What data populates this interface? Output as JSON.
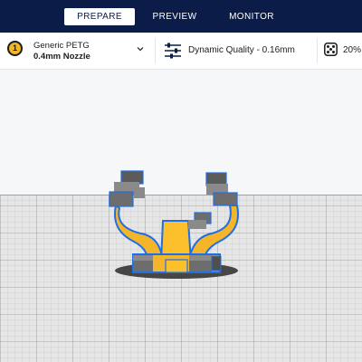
{
  "tabs": [
    {
      "label": "PREPARE",
      "active": true
    },
    {
      "label": "PREVIEW",
      "active": false
    },
    {
      "label": "MONITOR",
      "active": false
    }
  ],
  "material": {
    "extruder_number": "1",
    "name": "Generic PETG",
    "nozzle": "0.4mm Nozzle",
    "badge_color": "#f2b721"
  },
  "print_settings": {
    "quality": "Dynamic Quality - 0.16mm",
    "infill": "20%"
  },
  "colors": {
    "header": "#0a1c47",
    "model_fill": "#fcc02d",
    "selection_outline": "#1e6fe6",
    "build_plate": "#e6e6e6",
    "grid": "#a8aeb6"
  },
  "icons": {
    "material_dropdown": "chevron-down-icon",
    "quality": "sliders-icon",
    "infill": "infill-dots-icon"
  }
}
